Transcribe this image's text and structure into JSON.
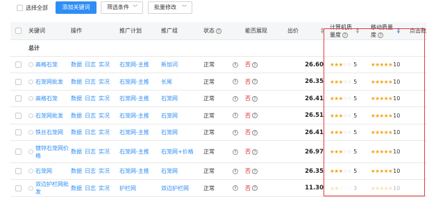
{
  "toolbar": {
    "select_all": "选择全部",
    "add_keyword": "添加关键词",
    "filter": "筛选条件",
    "batch_edit": "批量修改"
  },
  "headers": {
    "keyword": "关键词",
    "action": "操作",
    "campaign": "推广计划",
    "adgroup": "推广组",
    "status": "状态",
    "display": "能否展现",
    "bid": "出价",
    "pc_quality_1": "计算机质",
    "pc_quality_2": "量度",
    "mobile_quality_1": "移动质量",
    "mobile_quality_2": "度",
    "clicks": "点击数"
  },
  "total_label": "总计",
  "action_links": [
    "数据",
    "日志",
    "实况"
  ],
  "rows": [
    {
      "keyword": "高格石笼",
      "campaign": "石笼网-主推",
      "adgroup": "新加词",
      "status": "正常",
      "display": "否",
      "bid": "26.60",
      "pc_score": "5",
      "pc_stars": 2.5,
      "mobile_score": "10",
      "mobile_stars": 5
    },
    {
      "keyword": "石笼网批发",
      "campaign": "石笼网-主推",
      "adgroup": "长尾",
      "status": "正常",
      "display": "否",
      "bid": "26.35",
      "pc_score": "5",
      "pc_stars": 2.5,
      "mobile_score": "10",
      "mobile_stars": 5
    },
    {
      "keyword": "高格石笼",
      "campaign": "石笼网-主推",
      "adgroup": "石笼网",
      "status": "正常",
      "display": "否",
      "bid": "26.41",
      "pc_score": "5",
      "pc_stars": 2.5,
      "mobile_score": "10",
      "mobile_stars": 5
    },
    {
      "keyword": "石笼网批发",
      "campaign": "石笼网-主推",
      "adgroup": "石笼网",
      "status": "正常",
      "display": "否",
      "bid": "26.51",
      "pc_score": "5",
      "pc_stars": 2.5,
      "mobile_score": "10",
      "mobile_stars": 5
    },
    {
      "keyword": "铁丝石笼网",
      "campaign": "石笼网-主推",
      "adgroup": "石笼网",
      "status": "正常",
      "display": "否",
      "bid": "26.41",
      "pc_score": "5",
      "pc_stars": 2.5,
      "mobile_score": "10",
      "mobile_stars": 5
    },
    {
      "keyword": "镀锌石笼网价格",
      "campaign": "石笼网-主推",
      "adgroup": "石笼网+价格",
      "status": "正常",
      "display": "否",
      "bid": "26.97",
      "pc_score": "5",
      "pc_stars": 2.5,
      "mobile_score": "10",
      "mobile_stars": 5
    },
    {
      "keyword": "石笼网",
      "campaign": "石笼网-主推",
      "adgroup": "石笼网",
      "status": "正常",
      "display": "否",
      "bid": "26.35",
      "pc_score": "5",
      "pc_stars": 2.5,
      "mobile_score": "10",
      "mobile_stars": 5
    },
    {
      "keyword": "双边护栏网批发",
      "campaign": "护栏网",
      "adgroup": "双边护栏网",
      "status": "正常",
      "display": "否",
      "bid": "11.30",
      "pc_score": "3",
      "pc_stars": 1.5,
      "mobile_score": "10",
      "mobile_stars": 5
    }
  ]
}
